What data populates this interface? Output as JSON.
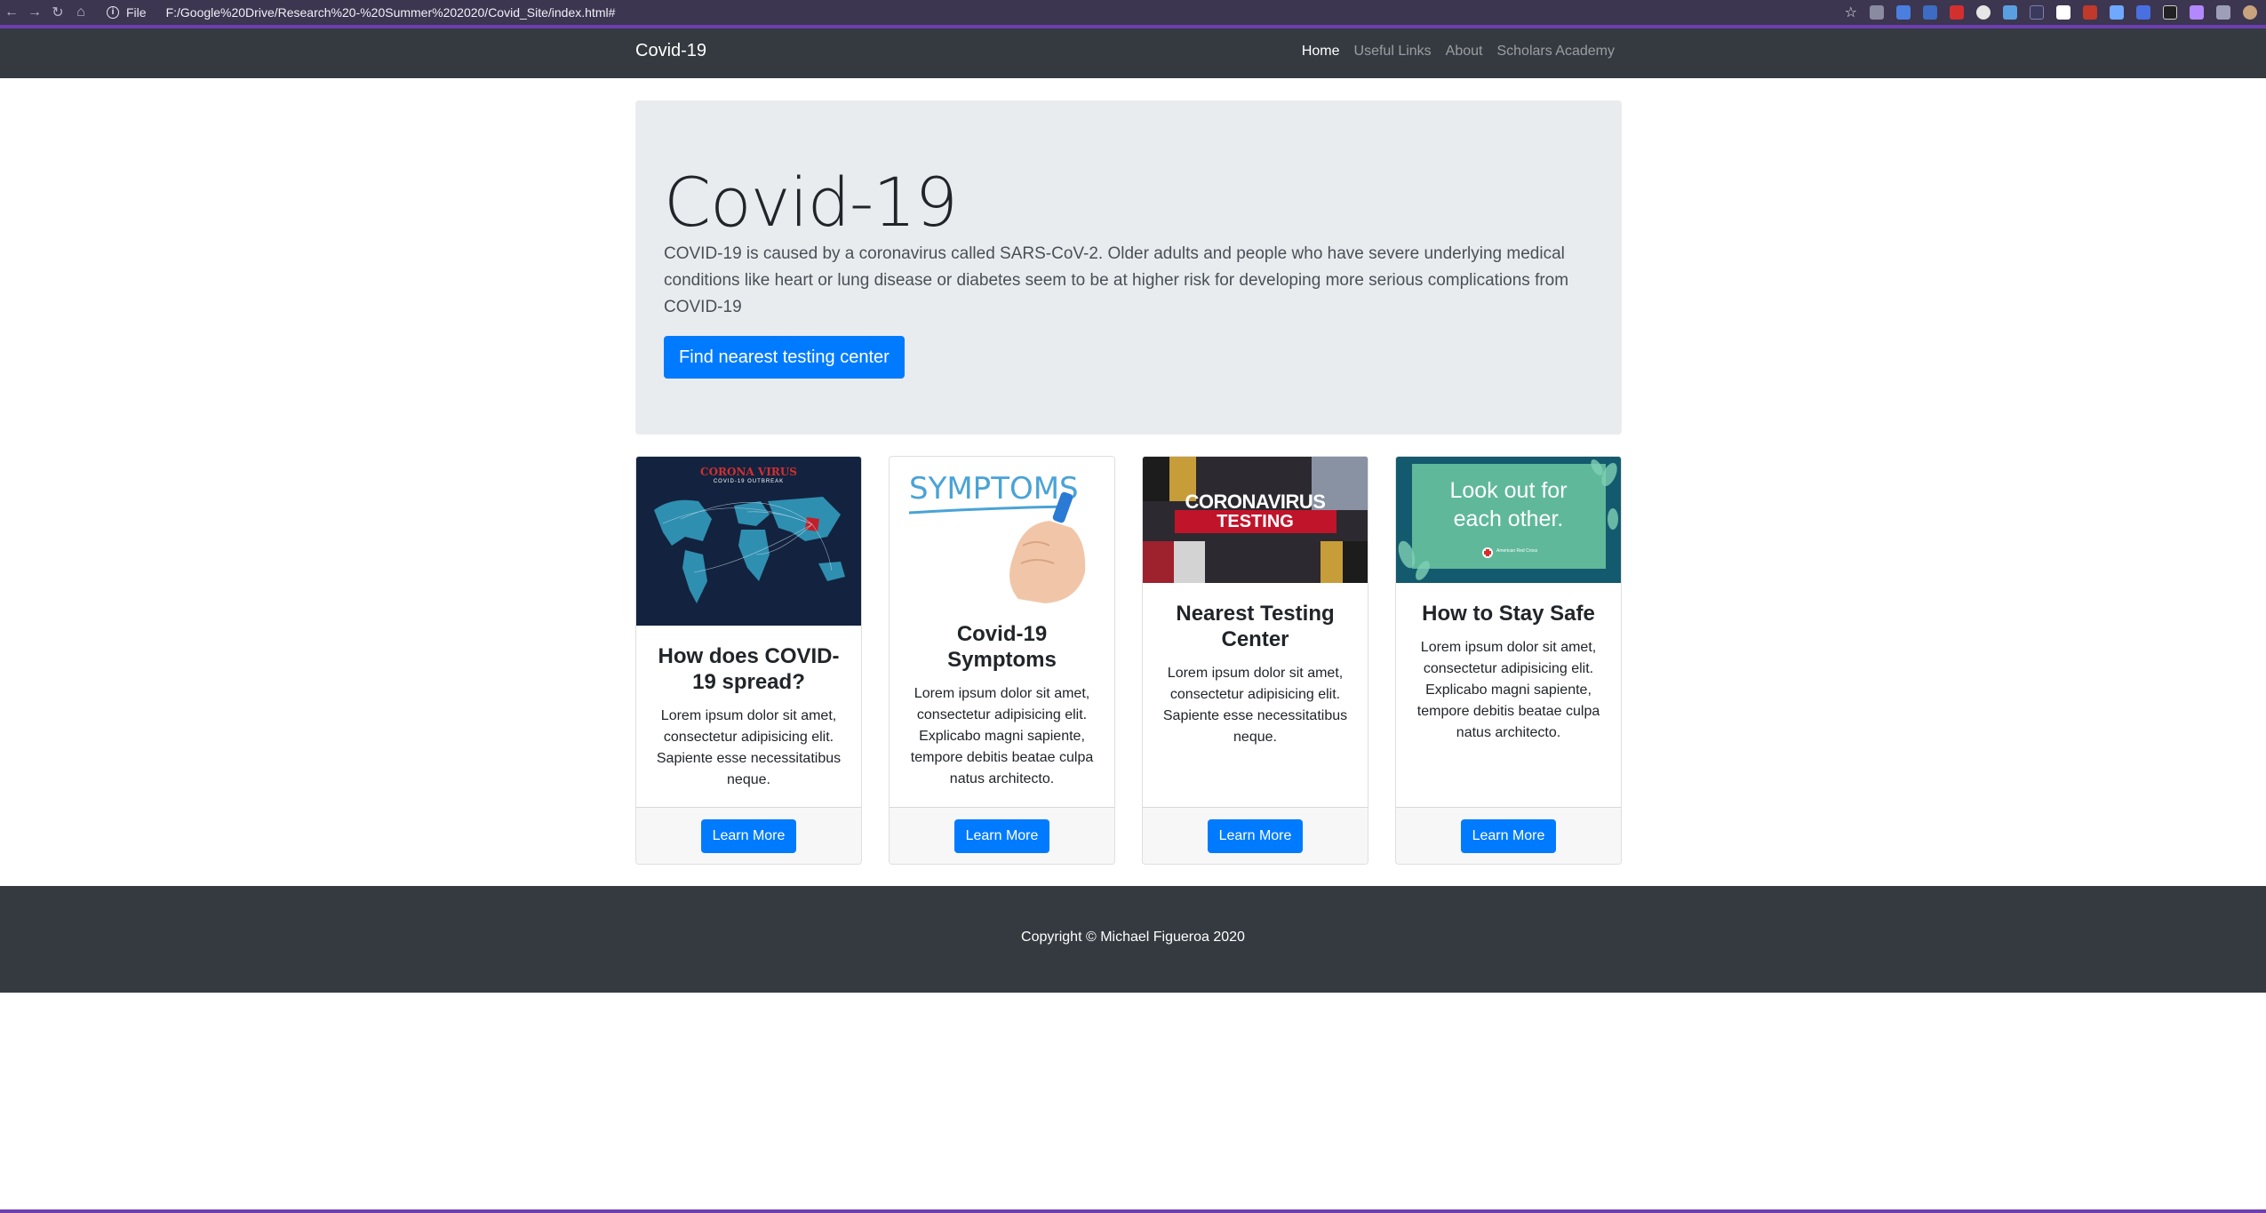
{
  "browser": {
    "file_label": "File",
    "url": "F:/Google%20Drive/Research%20-%20Summer%202020/Covid_Site/index.html#"
  },
  "navbar": {
    "brand": "Covid-19",
    "links": [
      "Home",
      "Useful Links",
      "About",
      "Scholars Academy"
    ],
    "active_link": "Home"
  },
  "jumbotron": {
    "title": "Covid-19",
    "text": "COVID-19 is caused by a coronavirus called SARS-CoV-2. Older adults and people who have severe underlying medical conditions like heart or lung disease or diabetes seem to be at higher risk for developing more serious complications from COVID-19",
    "button_label": "Find nearest testing center"
  },
  "cards": [
    {
      "image_caption": "CORONA VIRUS",
      "image_subcaption": "COVID-19 OUTBREAK",
      "title": "How does COVID-19 spread?",
      "text": "Lorem ipsum dolor sit amet, consectetur adipisicing elit. Sapiente esse necessitatibus neque.",
      "button_label": "Learn More"
    },
    {
      "image_caption": "SYMPTOMS",
      "title": "Covid-19 Symptoms",
      "text": "Lorem ipsum dolor sit amet, consectetur adipisicing elit. Explicabo magni sapiente, tempore debitis beatae culpa natus architecto.",
      "button_label": "Learn More"
    },
    {
      "image_caption": "CORONAVIRUS",
      "image_subcaption": "TESTING",
      "title": "Nearest Testing Center",
      "text": "Lorem ipsum dolor sit amet, consectetur adipisicing elit. Sapiente esse necessitatibus neque.",
      "button_label": "Learn More"
    },
    {
      "image_caption": "Look out for each other.",
      "image_subcaption": "American Red Cross",
      "title": "How to Stay Safe",
      "text": "Lorem ipsum dolor sit amet, consectetur adipisicing elit. Explicabo magni sapiente, tempore debitis beatae culpa natus architecto.",
      "button_label": "Learn More"
    }
  ],
  "footer": {
    "copyright": "Copyright © Michael Figueroa 2020"
  },
  "colors": {
    "primary": "#007bff",
    "dark": "#343a40",
    "jumbotron": "#e9ecef",
    "browser_accent": "#6c3fb0"
  }
}
